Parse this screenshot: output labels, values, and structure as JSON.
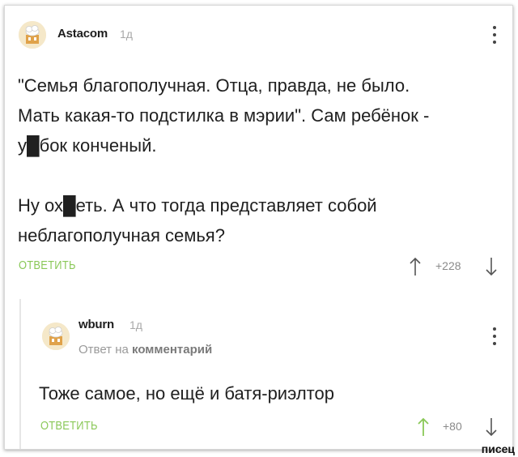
{
  "colors": {
    "accent": "#8ac858",
    "text": "#202020",
    "meta": "#a8a8a8"
  },
  "comment": {
    "author": "Astacom",
    "time": "1д",
    "text_lines": [
      "\"Семья благополучная. Отца, правда, не было.",
      "Мать какая-то подстилка в мэрии\". Сам ребёнок -",
      "у█бок конченый.",
      "",
      "Ну ох█еть. А что тогда представляет собой",
      "неблагополучная семья?"
    ],
    "reply_label": "ОТВЕТИТЬ",
    "rating": "+228",
    "icons": {
      "avatar": "avatar-icon",
      "menu": "more-vertical-icon",
      "upvote": "arrow-up-icon",
      "downvote": "arrow-down-icon"
    }
  },
  "child": {
    "author": "wburn",
    "time": "1д",
    "reply_to_prefix": "Ответ на",
    "reply_to_target": "комментарий",
    "text": "Тоже самое, но ещё и батя-риэлтор",
    "reply_label": "ОТВЕТИТЬ",
    "rating": "+80",
    "icons": {
      "avatar": "avatar-icon",
      "menu": "more-vertical-icon",
      "upvote": "arrow-up-icon",
      "downvote": "arrow-down-icon"
    }
  },
  "watermark": "писец"
}
